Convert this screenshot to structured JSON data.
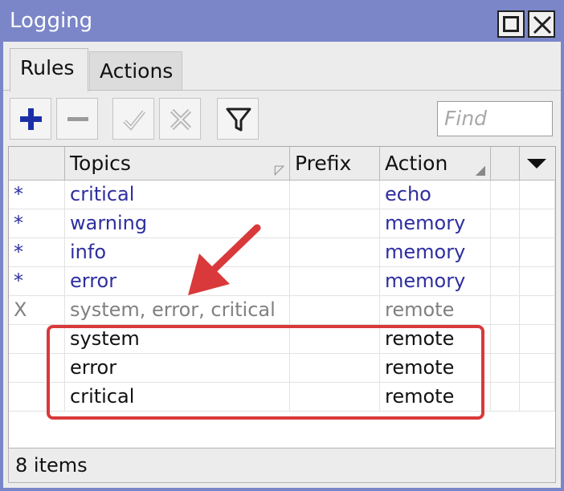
{
  "window": {
    "title": "Logging"
  },
  "tabs": [
    {
      "label": "Rules",
      "active": true
    },
    {
      "label": "Actions",
      "active": false
    }
  ],
  "toolbar": {
    "add_icon": "plus-icon",
    "remove_icon": "minus-icon",
    "enable_icon": "check-icon",
    "disable_icon": "x-icon",
    "filter_icon": "filter-icon",
    "find_placeholder": "Find"
  },
  "table": {
    "columns": [
      "",
      "Topics",
      "Prefix",
      "Action"
    ],
    "rows": [
      {
        "flag": "*",
        "topics": "critical",
        "prefix": "",
        "action": "echo",
        "style": "default"
      },
      {
        "flag": "*",
        "topics": "warning",
        "prefix": "",
        "action": "memory",
        "style": "default"
      },
      {
        "flag": "*",
        "topics": "info",
        "prefix": "",
        "action": "memory",
        "style": "default"
      },
      {
        "flag": "*",
        "topics": "error",
        "prefix": "",
        "action": "memory",
        "style": "default"
      },
      {
        "flag": "X",
        "topics": "system, error, critical",
        "prefix": "",
        "action": "remote",
        "style": "disabled"
      },
      {
        "flag": "",
        "topics": "system",
        "prefix": "",
        "action": "remote",
        "style": "normal"
      },
      {
        "flag": "",
        "topics": "error",
        "prefix": "",
        "action": "remote",
        "style": "normal"
      },
      {
        "flag": "",
        "topics": "critical",
        "prefix": "",
        "action": "remote",
        "style": "normal"
      }
    ]
  },
  "status": {
    "items_text": "8 items"
  },
  "colors": {
    "titlebar": "#7a86c8",
    "default_row_text": "#2e2ea0",
    "disabled_row_text": "#808080",
    "normal_row_text": "#111111",
    "annotation": "#d9393a"
  }
}
